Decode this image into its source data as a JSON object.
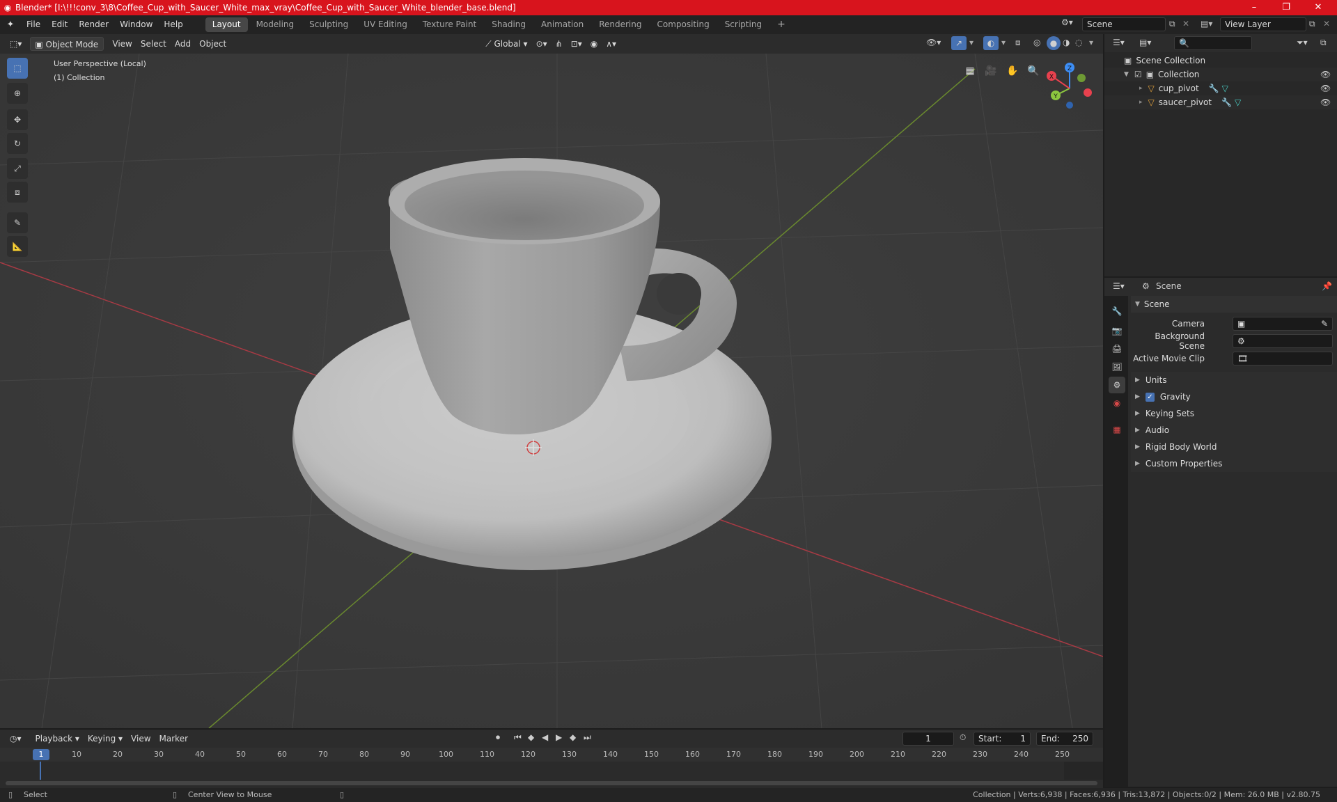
{
  "window": {
    "title": "Blender* [I:\\!!!conv_3\\8\\Coffee_Cup_with_Saucer_White_max_vray\\Coffee_Cup_with_Saucer_White_blender_base.blend]",
    "minimize": "–",
    "maximize": "❐",
    "close": "✕"
  },
  "menu": {
    "items": [
      "File",
      "Edit",
      "Render",
      "Window",
      "Help"
    ],
    "workspaces": [
      "Layout",
      "Modeling",
      "Sculpting",
      "UV Editing",
      "Texture Paint",
      "Shading",
      "Animation",
      "Rendering",
      "Compositing",
      "Scripting"
    ],
    "add_workspace": "+",
    "scene": "Scene",
    "view_layer": "View Layer"
  },
  "viewport_header": {
    "mode": "Object Mode",
    "menus": [
      "View",
      "Select",
      "Add",
      "Object"
    ],
    "orientation": "Global"
  },
  "viewport": {
    "perspective": "User Perspective (Local)",
    "collection": "(1) Collection",
    "gizmo": {
      "x": "X",
      "y": "Y",
      "z": "Z"
    }
  },
  "outliner": {
    "scene_collection": "Scene Collection",
    "collection": "Collection",
    "objects": [
      "cup_pivot",
      "saucer_pivot"
    ]
  },
  "properties": {
    "header": "Scene",
    "panel": "Scene",
    "camera_label": "Camera",
    "background_label": "Background Scene",
    "movie_clip_label": "Active Movie Clip",
    "sections": [
      "Units",
      "Gravity",
      "Keying Sets",
      "Audio",
      "Rigid Body World",
      "Custom Properties"
    ]
  },
  "timeline": {
    "menus": [
      "Playback",
      "Keying",
      "View",
      "Marker"
    ],
    "current_frame": "1",
    "start_label": "Start:",
    "start": "1",
    "end_label": "End:",
    "end": "250",
    "ruler": [
      "1",
      "10",
      "20",
      "30",
      "40",
      "50",
      "60",
      "70",
      "80",
      "90",
      "100",
      "110",
      "120",
      "130",
      "140",
      "150",
      "160",
      "170",
      "180",
      "190",
      "200",
      "210",
      "220",
      "230",
      "240",
      "250"
    ]
  },
  "status": {
    "select": "Select",
    "center": "Center View to Mouse",
    "stats": "Collection | Verts:6,938 | Faces:6,936 | Tris:13,872 | Objects:0/2 | Mem: 26.0 MB | v2.80.75"
  },
  "colors": {
    "title_bar": "#d8141d",
    "active_tool": "#4772b3",
    "axis_x": "#e8414e",
    "axis_y": "#8cc63f",
    "axis_z": "#3d8ef5"
  }
}
